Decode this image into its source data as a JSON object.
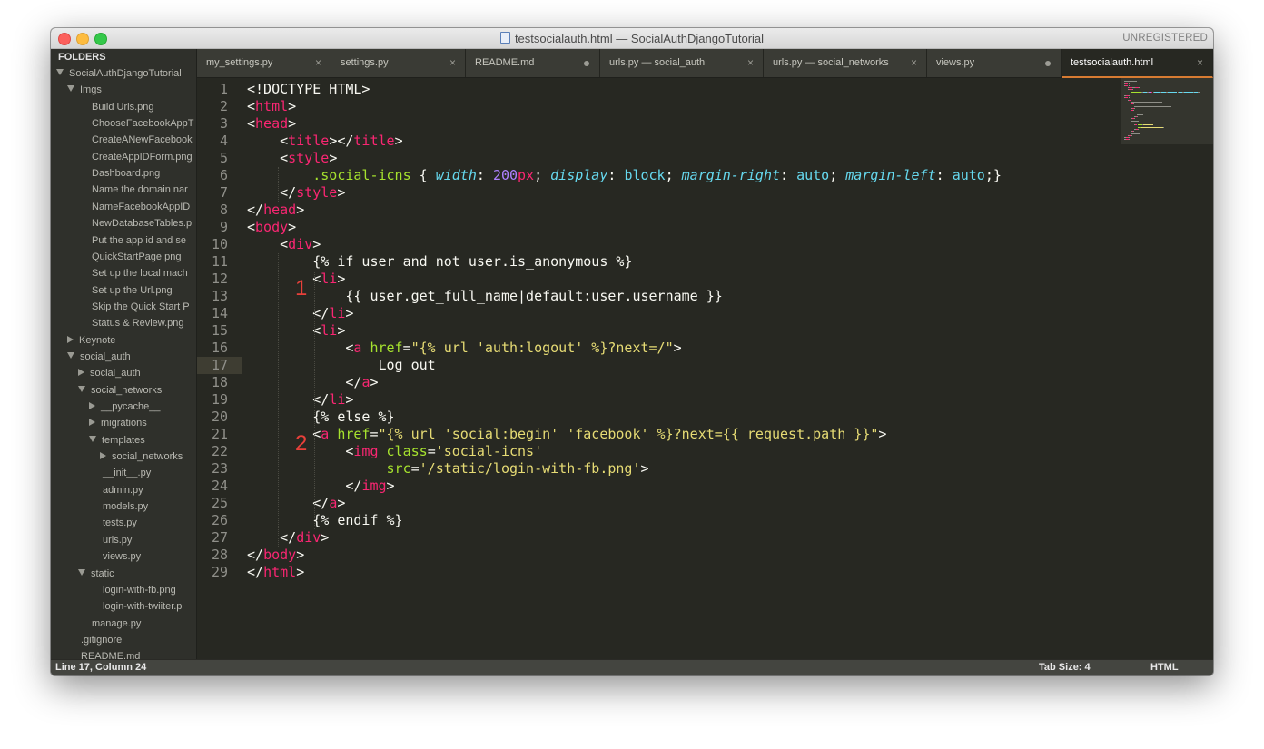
{
  "window": {
    "title": "testsocialauth.html — SocialAuthDjangoTutorial",
    "unregistered": "UNREGISTERED"
  },
  "sidebar": {
    "header": "FOLDERS",
    "items": [
      {
        "label": "SocialAuthDjangoTutorial",
        "kind": "folder",
        "expanded": true,
        "depth": 0
      },
      {
        "label": "Imgs",
        "kind": "folder",
        "expanded": true,
        "depth": 1
      },
      {
        "label": "Build Urls.png",
        "kind": "file",
        "depth": 2
      },
      {
        "label": "ChooseFacebookAppT",
        "kind": "file",
        "depth": 2
      },
      {
        "label": "CreateANewFacebook",
        "kind": "file",
        "depth": 2
      },
      {
        "label": "CreateAppIDForm.png",
        "kind": "file",
        "depth": 2
      },
      {
        "label": "Dashboard.png",
        "kind": "file",
        "depth": 2
      },
      {
        "label": "Name the domain nar",
        "kind": "file",
        "depth": 2
      },
      {
        "label": "NameFacebookAppID",
        "kind": "file",
        "depth": 2
      },
      {
        "label": "NewDatabaseTables.p",
        "kind": "file",
        "depth": 2
      },
      {
        "label": "Put the app id and se",
        "kind": "file",
        "depth": 2
      },
      {
        "label": "QuickStartPage.png",
        "kind": "file",
        "depth": 2
      },
      {
        "label": "Set up the local mach",
        "kind": "file",
        "depth": 2
      },
      {
        "label": "Set up the Url.png",
        "kind": "file",
        "depth": 2
      },
      {
        "label": "Skip the Quick Start P",
        "kind": "file",
        "depth": 2
      },
      {
        "label": "Status & Review.png",
        "kind": "file",
        "depth": 2
      },
      {
        "label": "Keynote",
        "kind": "folder",
        "expanded": false,
        "depth": 1
      },
      {
        "label": "social_auth",
        "kind": "folder",
        "expanded": true,
        "depth": 1
      },
      {
        "label": "social_auth",
        "kind": "folder",
        "expanded": false,
        "depth": 2
      },
      {
        "label": "social_networks",
        "kind": "folder",
        "expanded": true,
        "depth": 2
      },
      {
        "label": "__pycache__",
        "kind": "folder",
        "expanded": false,
        "depth": 3
      },
      {
        "label": "migrations",
        "kind": "folder",
        "expanded": false,
        "depth": 3
      },
      {
        "label": "templates",
        "kind": "folder",
        "expanded": true,
        "depth": 3
      },
      {
        "label": "social_networks",
        "kind": "folder",
        "expanded": false,
        "depth": 4
      },
      {
        "label": "__init__.py",
        "kind": "file",
        "depth": 3
      },
      {
        "label": "admin.py",
        "kind": "file",
        "depth": 3
      },
      {
        "label": "models.py",
        "kind": "file",
        "depth": 3
      },
      {
        "label": "tests.py",
        "kind": "file",
        "depth": 3
      },
      {
        "label": "urls.py",
        "kind": "file",
        "depth": 3
      },
      {
        "label": "views.py",
        "kind": "file",
        "depth": 3
      },
      {
        "label": "static",
        "kind": "folder",
        "expanded": true,
        "depth": 2
      },
      {
        "label": "login-with-fb.png",
        "kind": "file",
        "depth": 3
      },
      {
        "label": "login-with-twiiter.p",
        "kind": "file",
        "depth": 3
      },
      {
        "label": "manage.py",
        "kind": "file",
        "depth": 2
      },
      {
        "label": ".gitignore",
        "kind": "file",
        "depth": 1
      },
      {
        "label": "README.md",
        "kind": "file",
        "depth": 1
      }
    ]
  },
  "tabs": [
    {
      "label": "my_settings.py",
      "state": "close",
      "active": false
    },
    {
      "label": "settings.py",
      "state": "close",
      "active": false
    },
    {
      "label": "README.md",
      "state": "dirty",
      "active": false
    },
    {
      "label": "urls.py — social_auth",
      "state": "close",
      "active": false
    },
    {
      "label": "urls.py — social_networks",
      "state": "close",
      "active": false
    },
    {
      "label": "views.py",
      "state": "dirty",
      "active": false
    },
    {
      "label": "testsocialauth.html",
      "state": "close",
      "active": true
    }
  ],
  "editor": {
    "current_line": 17,
    "markers": [
      "1",
      "2"
    ],
    "lines": [
      [
        [
          "<!DOCTYPE HTML>",
          ""
        ]
      ],
      [
        [
          "<",
          ""
        ],
        [
          "html",
          "tag"
        ],
        [
          ">",
          ""
        ]
      ],
      [
        [
          "<",
          ""
        ],
        [
          "head",
          "tag"
        ],
        [
          ">",
          ""
        ]
      ],
      [
        [
          "    <",
          ""
        ],
        [
          "title",
          "tag"
        ],
        [
          "></",
          ""
        ],
        [
          "title",
          "tag"
        ],
        [
          ">",
          ""
        ]
      ],
      [
        [
          "    <",
          ""
        ],
        [
          "style",
          "tag"
        ],
        [
          ">",
          ""
        ]
      ],
      [
        [
          "        ",
          ""
        ],
        [
          ".social-icns",
          "attr"
        ],
        [
          " { ",
          ""
        ],
        [
          "width",
          "prop"
        ],
        [
          ": ",
          ""
        ],
        [
          "200",
          "num"
        ],
        [
          "px",
          "unit"
        ],
        [
          "; ",
          ""
        ],
        [
          "display",
          "prop"
        ],
        [
          ": ",
          ""
        ],
        [
          "block",
          "val"
        ],
        [
          "; ",
          ""
        ],
        [
          "margin-right",
          "prop"
        ],
        [
          ": ",
          ""
        ],
        [
          "auto",
          "val"
        ],
        [
          "; ",
          ""
        ],
        [
          "margin-left",
          "prop"
        ],
        [
          ": ",
          ""
        ],
        [
          "auto",
          "val"
        ],
        [
          ";}",
          ""
        ]
      ],
      [
        [
          "    </",
          ""
        ],
        [
          "style",
          "tag"
        ],
        [
          ">",
          ""
        ]
      ],
      [
        [
          "</",
          ""
        ],
        [
          "head",
          "tag"
        ],
        [
          ">",
          ""
        ]
      ],
      [
        [
          "<",
          ""
        ],
        [
          "body",
          "tag"
        ],
        [
          ">",
          ""
        ]
      ],
      [
        [
          "    <",
          ""
        ],
        [
          "div",
          "tag"
        ],
        [
          ">",
          ""
        ]
      ],
      [
        [
          "        {% if user and not user.is_anonymous %}",
          ""
        ]
      ],
      [
        [
          "        <",
          ""
        ],
        [
          "li",
          "tag"
        ],
        [
          ">",
          ""
        ]
      ],
      [
        [
          "            {{ user.get_full_name|default:user.username }}",
          ""
        ]
      ],
      [
        [
          "        </",
          ""
        ],
        [
          "li",
          "tag"
        ],
        [
          ">",
          ""
        ]
      ],
      [
        [
          "        <",
          ""
        ],
        [
          "li",
          "tag"
        ],
        [
          ">",
          ""
        ]
      ],
      [
        [
          "            <",
          ""
        ],
        [
          "a",
          "tag"
        ],
        [
          " ",
          ""
        ],
        [
          "href",
          "attr"
        ],
        [
          "=",
          ""
        ],
        [
          "\"{% url 'auth:logout' %}?next=/\"",
          "str"
        ],
        [
          ">",
          ""
        ]
      ],
      [
        [
          "                Log out",
          ""
        ]
      ],
      [
        [
          "            </",
          ""
        ],
        [
          "a",
          "tag"
        ],
        [
          ">",
          ""
        ]
      ],
      [
        [
          "        </",
          ""
        ],
        [
          "li",
          "tag"
        ],
        [
          ">",
          ""
        ]
      ],
      [
        [
          "        {% else %}",
          ""
        ]
      ],
      [
        [
          "        <",
          ""
        ],
        [
          "a",
          "tag"
        ],
        [
          " ",
          ""
        ],
        [
          "href",
          "attr"
        ],
        [
          "=",
          ""
        ],
        [
          "\"{% url 'social:begin' 'facebook' %}?next={{ request.path }}\"",
          "str"
        ],
        [
          ">",
          ""
        ]
      ],
      [
        [
          "            <",
          ""
        ],
        [
          "img",
          "tag"
        ],
        [
          " ",
          ""
        ],
        [
          "class",
          "attr"
        ],
        [
          "=",
          ""
        ],
        [
          "'social-icns'",
          "str"
        ]
      ],
      [
        [
          "                 ",
          ""
        ],
        [
          "src",
          "attr"
        ],
        [
          "=",
          ""
        ],
        [
          "'/static/login-with-fb.png'",
          "str"
        ],
        [
          ">",
          ""
        ]
      ],
      [
        [
          "            </",
          ""
        ],
        [
          "img",
          "tag"
        ],
        [
          ">",
          ""
        ]
      ],
      [
        [
          "        </",
          ""
        ],
        [
          "a",
          "tag"
        ],
        [
          ">",
          ""
        ]
      ],
      [
        [
          "        {% endif %}",
          ""
        ]
      ],
      [
        [
          "    </",
          ""
        ],
        [
          "div",
          "tag"
        ],
        [
          ">",
          ""
        ]
      ],
      [
        [
          "</",
          ""
        ],
        [
          "body",
          "tag"
        ],
        [
          ">",
          ""
        ]
      ],
      [
        [
          "</",
          ""
        ],
        [
          "html",
          "tag"
        ],
        [
          ">",
          ""
        ]
      ]
    ]
  },
  "status": {
    "position": "Line 17, Column 24",
    "tab_size": "Tab Size: 4",
    "syntax": "HTML"
  },
  "colors": {
    "tag": "#f92672",
    "attr": "#a6e22e",
    "string": "#e6db74",
    "keyword": "#66d9ef",
    "number": "#ae81ff",
    "background": "#272822",
    "active_tab_accent": "#d77b32",
    "marker": "#e8403a"
  }
}
